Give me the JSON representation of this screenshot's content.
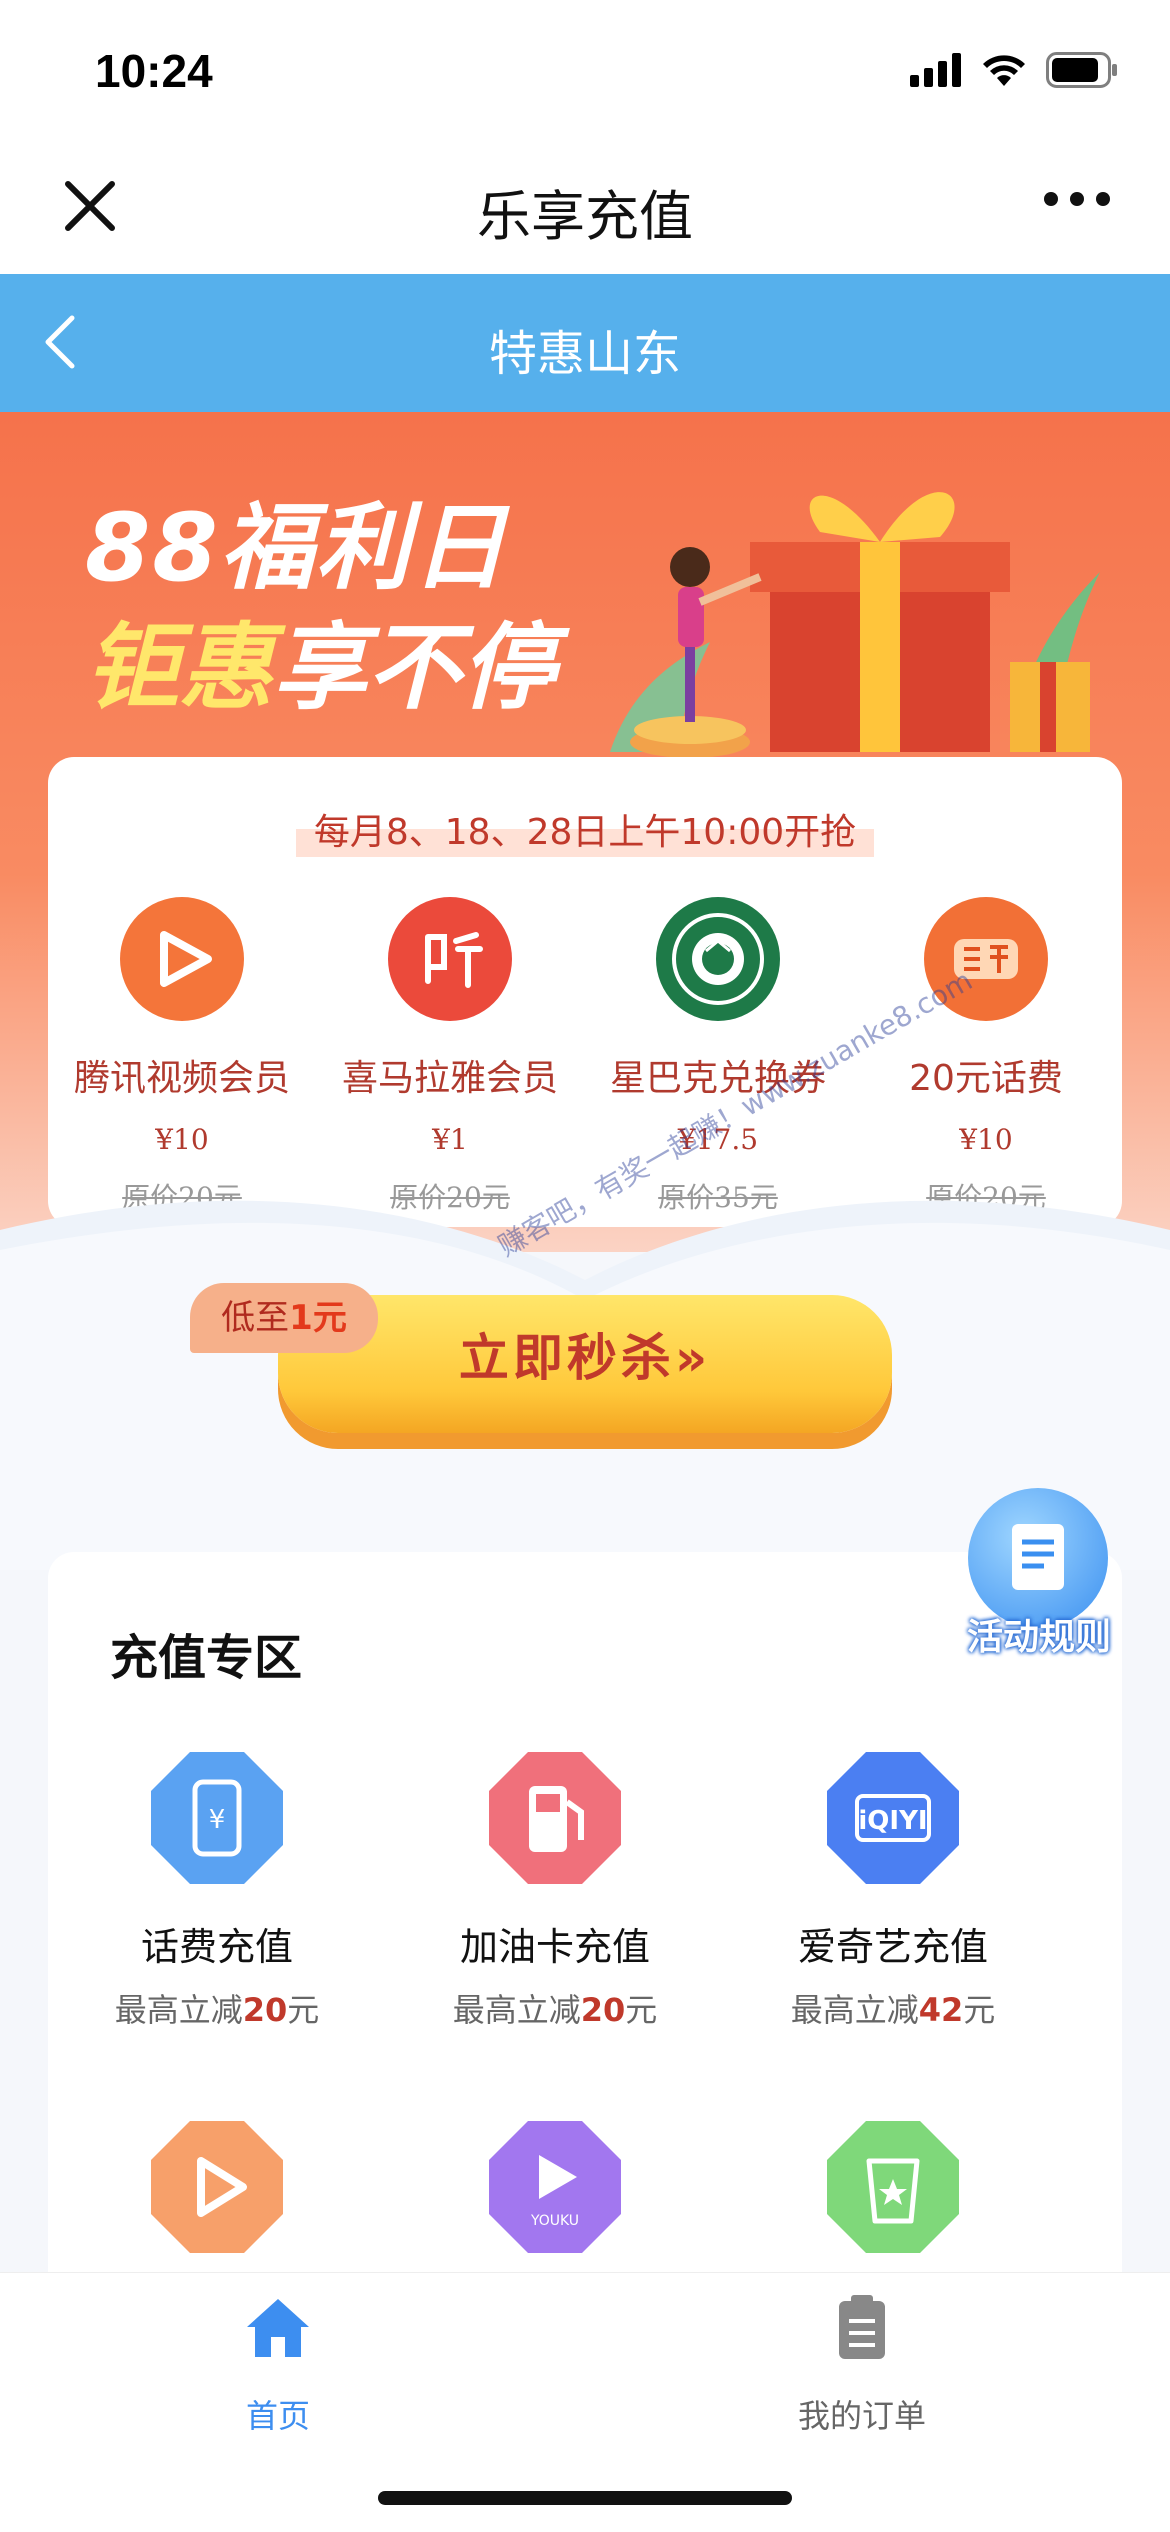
{
  "status_bar": {
    "time": "10:24"
  },
  "title_bar": {
    "title": "乐享充值"
  },
  "nav_bar": {
    "title": "特惠山东"
  },
  "banner": {
    "line1": "88福利日",
    "line2_highlight": "钜惠",
    "line2_rest": "享不停"
  },
  "flash_sale": {
    "schedule": "每月8、18、28日上午10:00开抢",
    "products": [
      {
        "name": "腾讯视频会员",
        "price": "¥10",
        "original": "原价20元",
        "icon": "tencent-video-icon",
        "color": "#f4753a"
      },
      {
        "name": "喜马拉雅会员",
        "price": "¥1",
        "original": "原价20元",
        "icon": "ximalaya-icon",
        "color": "#eb4a3b"
      },
      {
        "name": "星巴克兑换券",
        "price": "¥17.5",
        "original": "原价35元",
        "icon": "starbucks-icon",
        "color": "#1e7a48"
      },
      {
        "name": "20元话费",
        "price": "¥10",
        "original": "原价20元",
        "icon": "phone-bill-icon",
        "color": "#f27036"
      }
    ],
    "tag_prefix": "低至",
    "tag_value": "1元",
    "button": "立即秒杀»"
  },
  "watermark": "赚客吧，有奖一起赚！www.zuanke8.com",
  "floating": {
    "label": "活动规则"
  },
  "recharge_zone": {
    "heading": "充值专区",
    "items": [
      {
        "name": "话费充值",
        "prefix": "最高立减",
        "amount": "20",
        "suffix": "元",
        "icon": "phone-yuan-icon",
        "color": "#5aa2f2"
      },
      {
        "name": "加油卡充值",
        "prefix": "最高立减",
        "amount": "20",
        "suffix": "元",
        "icon": "gas-station-icon",
        "color": "#f0707b"
      },
      {
        "name": "爱奇艺充值",
        "prefix": "最高立减",
        "amount": "42",
        "suffix": "元",
        "icon": "iqiyi-icon",
        "color": "#4b7ff2"
      },
      {
        "icon": "tencent-video-icon",
        "color": "#f7a06a"
      },
      {
        "icon": "youku-icon",
        "color": "#a277ef"
      },
      {
        "icon": "starbucks-cup-icon",
        "color": "#7fd87a"
      }
    ]
  },
  "tabs": [
    {
      "label": "首页",
      "active": true
    },
    {
      "label": "我的订单",
      "active": false
    }
  ]
}
